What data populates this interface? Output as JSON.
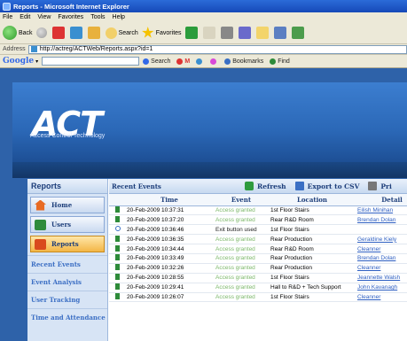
{
  "window": {
    "title": "Reports - Microsoft Internet Explorer"
  },
  "menu": [
    "File",
    "Edit",
    "View",
    "Favorites",
    "Tools",
    "Help"
  ],
  "toolbar": {
    "back_label": "Back",
    "search_label": "Search",
    "favorites_label": "Favorites"
  },
  "address": {
    "label": "Address",
    "url": "http://actreg/ACTWeb/Reports.aspx?id=1"
  },
  "google_bar": {
    "logo": "Google",
    "items": [
      "Search",
      "M",
      "Bookmarks",
      "Find"
    ]
  },
  "site": {
    "logo": "ACT",
    "tagline": "Access Control Technology"
  },
  "sidebar": {
    "title": "Reports",
    "buttons": [
      {
        "label": "Home",
        "icon": "home-icon"
      },
      {
        "label": "Users",
        "icon": "users-icon"
      },
      {
        "label": "Reports",
        "icon": "reports-icon",
        "active": true
      }
    ],
    "links": [
      "Recent Events",
      "Event Analysis",
      "User Tracking",
      "Time and Attendance"
    ]
  },
  "main": {
    "title": "Recent Events",
    "actions": [
      "Refresh",
      "Export to CSV",
      "Pri"
    ]
  },
  "table": {
    "columns": [
      "",
      "Time",
      "Event",
      "Location",
      "Detail"
    ],
    "rows": [
      {
        "icon": "door",
        "time": "20-Feb-2009 10:37:31",
        "event": "Access granted",
        "location": "1st Floor Stairs",
        "detail": "Eilish Minihan"
      },
      {
        "icon": "door",
        "time": "20-Feb-2009 10:37:20",
        "event": "Access granted",
        "location": "Rear R&D Room",
        "detail": "Brendan Dolan"
      },
      {
        "icon": "info",
        "time": "20-Feb-2009 10:36:46",
        "event": "Exit button used",
        "location": "1st Floor Stairs",
        "detail": ""
      },
      {
        "icon": "door",
        "time": "20-Feb-2009 10:36:35",
        "event": "Access granted",
        "location": "Rear Production",
        "detail": "Geraldine Kiely"
      },
      {
        "icon": "door",
        "time": "20-Feb-2009 10:34:44",
        "event": "Access granted",
        "location": "Rear R&D Room",
        "detail": "Cleanner"
      },
      {
        "icon": "door",
        "time": "20-Feb-2009 10:33:49",
        "event": "Access granted",
        "location": "Rear Production",
        "detail": "Brendan Dolan"
      },
      {
        "icon": "door",
        "time": "20-Feb-2009 10:32:26",
        "event": "Access granted",
        "location": "Rear Production",
        "detail": "Cleanner"
      },
      {
        "icon": "door",
        "time": "20-Feb-2009 10:28:55",
        "event": "Access granted",
        "location": "1st Floor Stairs",
        "detail": "Jeannette Walsh"
      },
      {
        "icon": "door",
        "time": "20-Feb-2009 10:29:41",
        "event": "Access granted",
        "location": "Hall to R&D + Tech Support",
        "detail": "John Kavanagh"
      },
      {
        "icon": "door",
        "time": "20-Feb-2009 10:26:07",
        "event": "Access granted",
        "location": "1st Floor Stairs",
        "detail": "Cleanner"
      }
    ]
  },
  "colors": {
    "page_blue": "#2e62a9",
    "granted_green": "#7db86b",
    "link_blue": "#2e5fc2"
  }
}
